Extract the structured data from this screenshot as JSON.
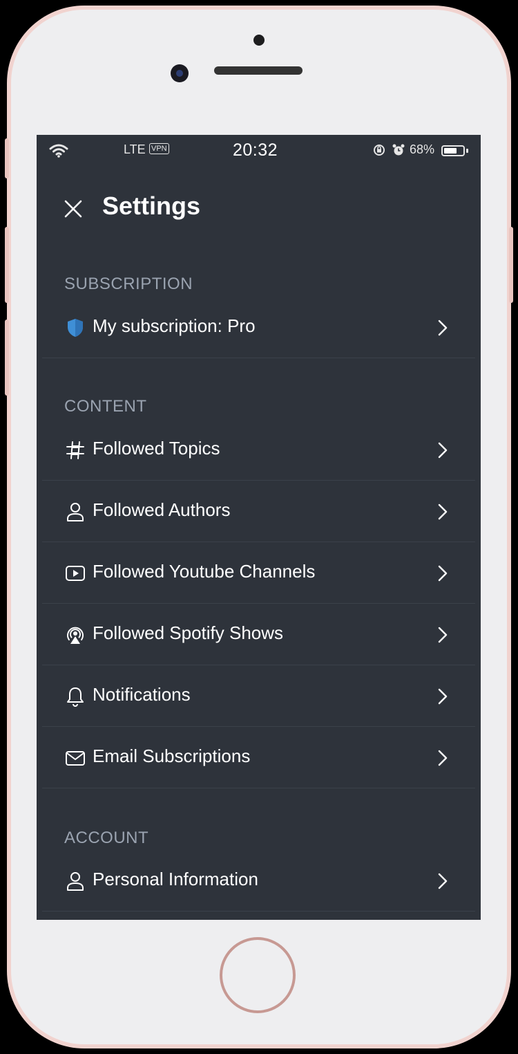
{
  "status_bar": {
    "network": "LTE",
    "vpn": "VPN",
    "time": "20:32",
    "battery_percent": "68%",
    "battery_level": 0.68
  },
  "header": {
    "title": "Settings",
    "close_icon": "close-icon"
  },
  "sections": {
    "subscription": {
      "label": "SUBSCRIPTION",
      "items": [
        {
          "label": "My subscription: Pro",
          "icon": "shield-icon"
        }
      ]
    },
    "content": {
      "label": "CONTENT",
      "items": [
        {
          "label": "Followed Topics",
          "icon": "hashtag-icon"
        },
        {
          "label": "Followed Authors",
          "icon": "person-icon"
        },
        {
          "label": "Followed Youtube Channels",
          "icon": "youtube-play-icon"
        },
        {
          "label": "Followed Spotify Shows",
          "icon": "podcast-icon"
        },
        {
          "label": "Notifications",
          "icon": "bell-icon"
        },
        {
          "label": "Email Subscriptions",
          "icon": "envelope-icon"
        }
      ]
    },
    "account": {
      "label": "ACCOUNT",
      "items": [
        {
          "label": "Personal Information",
          "icon": "person-icon"
        }
      ]
    }
  },
  "colors": {
    "screen_background": "#2e333b",
    "section_label": "#9aa3b0",
    "shield_blue": "#3f8fd6",
    "phone_frame": "#f1d3cf"
  }
}
